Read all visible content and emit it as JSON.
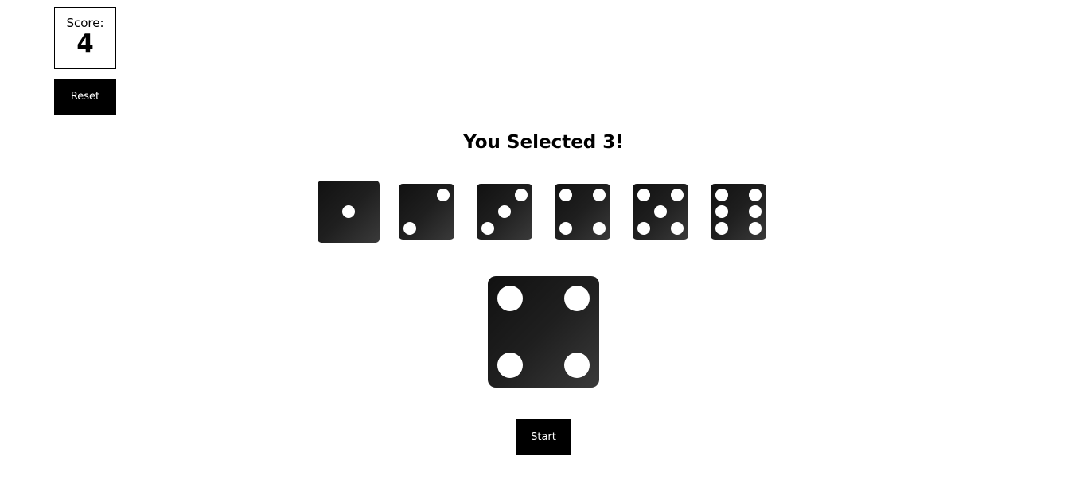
{
  "score": {
    "label": "Score:",
    "value": "4"
  },
  "reset_label": "Reset",
  "status_title": "You Selected 3!",
  "dice_options": [
    {
      "face": 1,
      "icon": "die-face-1-icon",
      "selected": true
    },
    {
      "face": 2,
      "icon": "die-face-2-icon",
      "selected": false
    },
    {
      "face": 3,
      "icon": "die-face-3-icon",
      "selected": false
    },
    {
      "face": 4,
      "icon": "die-face-4-icon",
      "selected": false
    },
    {
      "face": 5,
      "icon": "die-face-5-icon",
      "selected": false
    },
    {
      "face": 6,
      "icon": "die-face-6-icon",
      "selected": false
    }
  ],
  "rolled_die": {
    "face": 4,
    "icon": "die-face-4-icon"
  },
  "start_label": "Start",
  "colors": {
    "background": "#ffffff",
    "button": "#000000",
    "button_text": "#ffffff",
    "die": "#1f1f1f",
    "pip": "#ffffff"
  }
}
